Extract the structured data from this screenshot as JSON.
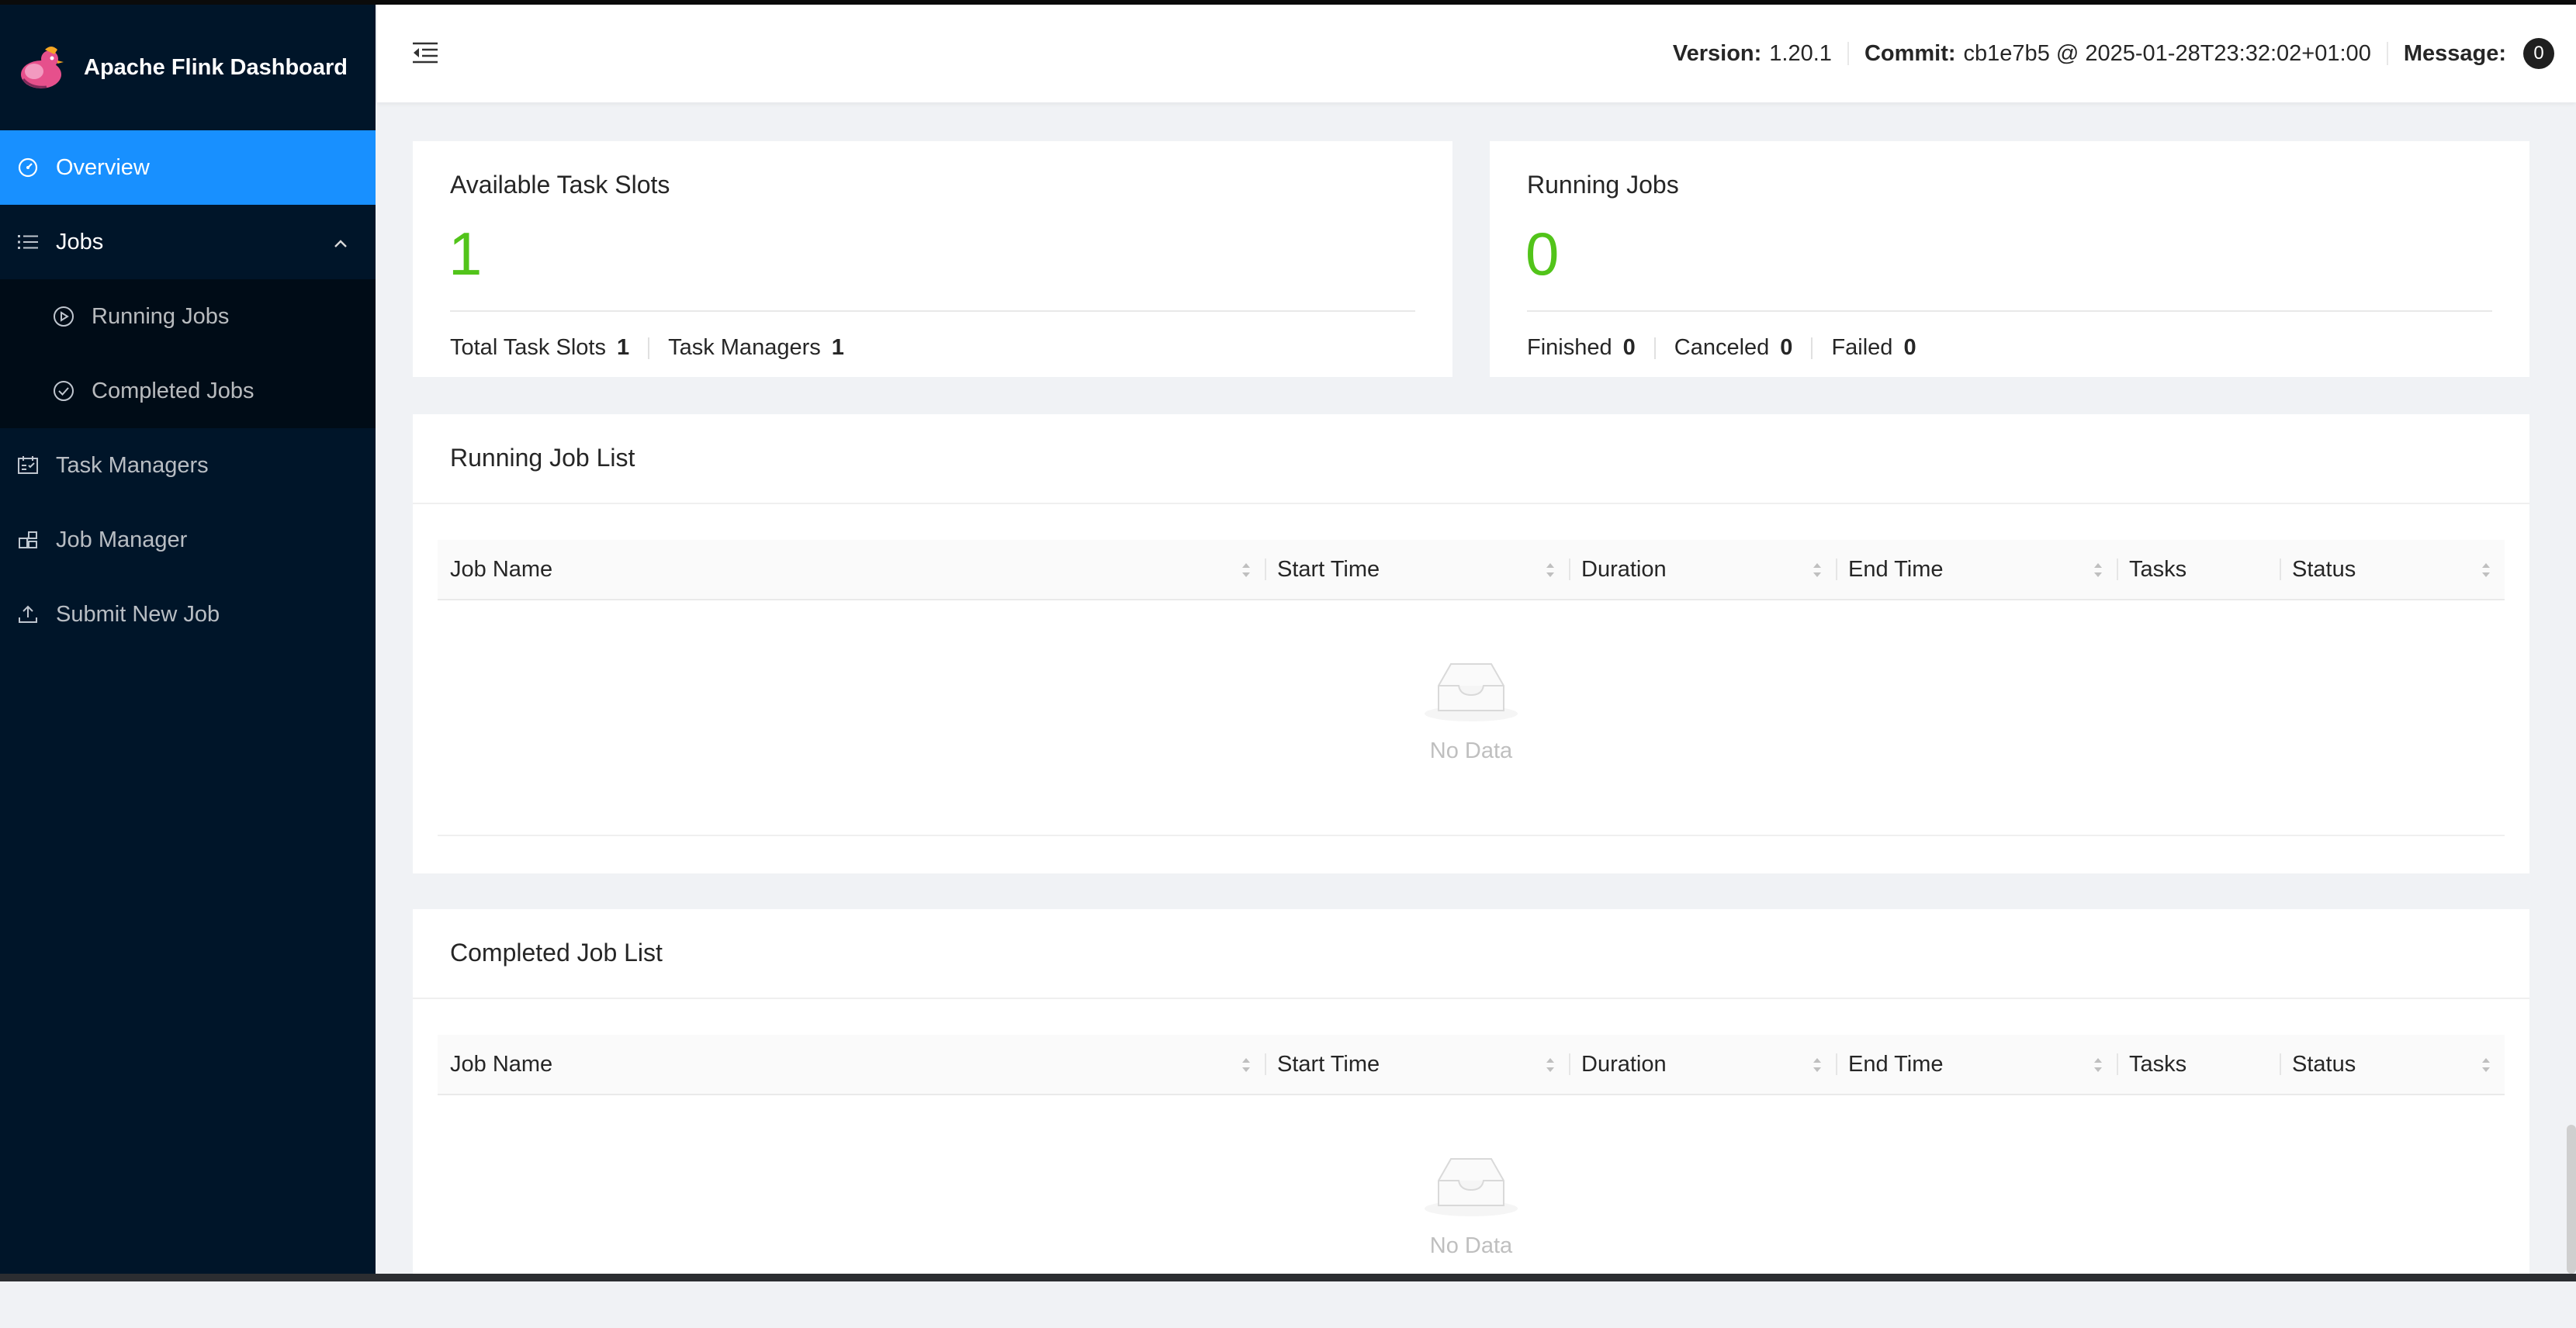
{
  "app": {
    "title": "Apache Flink Dashboard"
  },
  "sidebar": {
    "items": [
      {
        "label": "Overview"
      },
      {
        "label": "Jobs"
      },
      {
        "label": "Running Jobs"
      },
      {
        "label": "Completed Jobs"
      },
      {
        "label": "Task Managers"
      },
      {
        "label": "Job Manager"
      },
      {
        "label": "Submit New Job"
      }
    ]
  },
  "header": {
    "version_label": "Version:",
    "version_value": "1.20.1",
    "commit_label": "Commit:",
    "commit_value": "cb1e7b5 @ 2025-01-28T23:32:02+01:00",
    "message_label": "Message:",
    "message_count": "0"
  },
  "task_slots": {
    "title": "Available Task Slots",
    "value": "1",
    "total_label": "Total Task Slots",
    "total_value": "1",
    "managers_label": "Task Managers",
    "managers_value": "1"
  },
  "running_jobs": {
    "title": "Running Jobs",
    "value": "0",
    "finished_label": "Finished",
    "finished_value": "0",
    "canceled_label": "Canceled",
    "canceled_value": "0",
    "failed_label": "Failed",
    "failed_value": "0"
  },
  "running_list": {
    "title": "Running Job List",
    "columns": [
      "Job Name",
      "Start Time",
      "Duration",
      "End Time",
      "Tasks",
      "Status"
    ],
    "empty_text": "No Data"
  },
  "completed_list": {
    "title": "Completed Job List",
    "columns": [
      "Job Name",
      "Start Time",
      "Duration",
      "End Time",
      "Tasks",
      "Status"
    ],
    "empty_text": "No Data"
  },
  "colors": {
    "sidebar_bg": "#001529",
    "active": "#1890ff",
    "stat_green": "#52c41a"
  }
}
